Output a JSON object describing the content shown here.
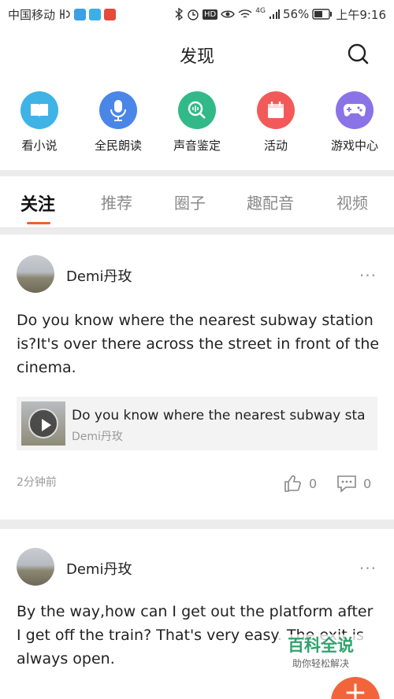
{
  "status_bar": {
    "carrier": "中国移动",
    "signal_extra": "4G",
    "battery": "56%",
    "time": "上午9:16",
    "hd": "HD"
  },
  "header": {
    "title": "发现"
  },
  "quick_links": [
    {
      "label": "看小说",
      "icon": "book-icon",
      "color": "#3fb3e6"
    },
    {
      "label": "全民朗读",
      "icon": "microphone-icon",
      "color": "#4a86e8"
    },
    {
      "label": "声音鉴定",
      "icon": "voice-search-icon",
      "color": "#31b98a"
    },
    {
      "label": "活动",
      "icon": "calendar-icon",
      "color": "#f25a5a"
    },
    {
      "label": "游戏中心",
      "icon": "gamepad-icon",
      "color": "#8a73e6"
    }
  ],
  "tabs": [
    {
      "label": "关注",
      "active": true
    },
    {
      "label": "推荐",
      "active": false
    },
    {
      "label": "圈子",
      "active": false
    },
    {
      "label": "趣配音",
      "active": false
    },
    {
      "label": "视频",
      "active": false
    }
  ],
  "posts": [
    {
      "user": "Demi丹玫",
      "text": "Do you know where the nearest subway station is?It's over there across the street in front of the cinema.",
      "audio": {
        "title": "Do you know where the nearest subway sta",
        "author": "Demi丹玫"
      },
      "time": "2分钟前",
      "likes": "0",
      "comments": "0"
    },
    {
      "user": "Demi丹玫",
      "text": "By the way,how can I get out the platform after I get off the train? That's very easy. The exit is always open."
    }
  ],
  "watermark": {
    "main": "百科全说",
    "sub": "助你轻松解决"
  },
  "fab": {
    "label": "+"
  },
  "more_label": "···"
}
